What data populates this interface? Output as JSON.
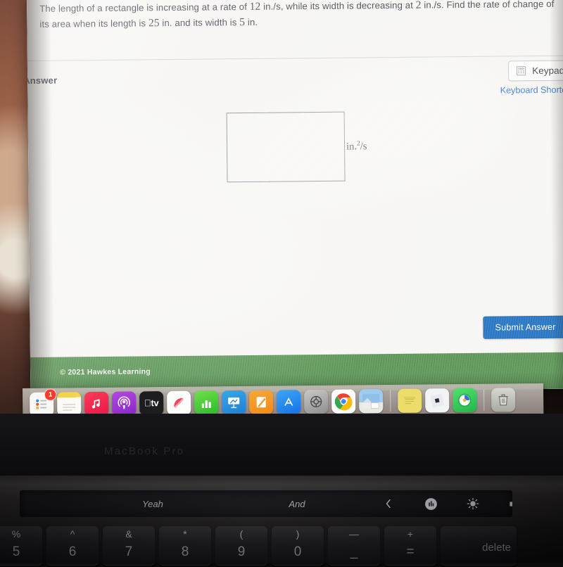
{
  "question": {
    "line1_a": "The length of a rectangle is increasing at a rate of ",
    "line1_n1": "12",
    "line1_b": " in./s, while its width is decreasing at ",
    "line1_n2": "2",
    "line1_c": " in./s. Find the rate of change of",
    "line2_a": "its area when its length is ",
    "line2_n1": "25",
    "line2_b": " in. and its width is ",
    "line2_n2": "5",
    "line2_c": " in."
  },
  "answer_panel": {
    "label": "Answer",
    "keypad_label": "Keypad",
    "keypad_icon": "calculator-icon",
    "keyboard_shortcuts_label": "Keyboard Shortcuts",
    "input_value": "",
    "input_placeholder": "",
    "units_base": "in.",
    "units_exponent": "2",
    "units_suffix": "/s",
    "submit_label": "Submit Answer"
  },
  "footer": {
    "copyright": "© 2021 Hawkes Learning",
    "bar_color": "#56914f"
  },
  "colors": {
    "submit_blue": "#1d6fc0",
    "link_blue": "#2f6fc4",
    "footer_green": "#56914f"
  },
  "dock": {
    "items": [
      {
        "name": "reminders",
        "icon": "reminders-icon",
        "badge": "1",
        "running": false
      },
      {
        "name": "notes",
        "icon": "notes-icon",
        "badge": "",
        "running": false
      },
      {
        "name": "music",
        "icon": "music-note-icon",
        "badge": "",
        "running": false
      },
      {
        "name": "podcasts",
        "icon": "podcasts-icon",
        "badge": "",
        "running": false
      },
      {
        "name": "apple-tv",
        "icon": "apple-tv-icon",
        "label": "tv",
        "badge": "",
        "running": false
      },
      {
        "name": "news",
        "icon": "news-icon",
        "badge": "",
        "running": false
      },
      {
        "name": "numbers",
        "icon": "numbers-bar-chart-icon",
        "badge": "",
        "running": false
      },
      {
        "name": "keynote",
        "icon": "keynote-podium-icon",
        "badge": "",
        "running": false
      },
      {
        "name": "pages",
        "icon": "pages-pen-icon",
        "badge": "",
        "running": false
      },
      {
        "name": "app-store",
        "icon": "app-store-icon",
        "badge": "",
        "running": false
      },
      {
        "name": "system-preferences",
        "icon": "gear-icon",
        "badge": "",
        "running": false
      },
      {
        "name": "google-chrome",
        "icon": "chrome-icon",
        "badge": "",
        "running": true
      },
      {
        "name": "preview",
        "icon": "preview-photo-icon",
        "badge": "",
        "running": false
      },
      {
        "name": "stickies",
        "icon": "sticky-note-icon",
        "badge": "",
        "running": false
      },
      {
        "name": "roblox",
        "icon": "roblox-icon",
        "badge": "",
        "running": false
      },
      {
        "name": "find-my",
        "icon": "find-my-icon",
        "badge": "",
        "running": false
      },
      {
        "name": "trash",
        "icon": "trash-icon",
        "badge": "",
        "running": false
      }
    ]
  },
  "laptop": {
    "model_label": "MacBook Pro"
  },
  "touch_bar": {
    "escape_label": "/",
    "suggestions": [
      "Yeah",
      "And"
    ],
    "controls": [
      {
        "name": "expand-left",
        "icon": "chevron-left-icon"
      },
      {
        "name": "media",
        "icon": "equalizer-icon"
      },
      {
        "name": "brightness",
        "icon": "brightness-icon"
      },
      {
        "name": "volume-up",
        "icon": "speaker-icon"
      },
      {
        "name": "mute",
        "icon": "speaker-mute-icon"
      }
    ],
    "siri_icon": "siri-icon"
  },
  "keyboard": {
    "keys": [
      {
        "top": "%",
        "bottom": "5"
      },
      {
        "top": "^",
        "bottom": "6"
      },
      {
        "top": "&",
        "bottom": "7"
      },
      {
        "top": "*",
        "bottom": "8"
      },
      {
        "top": "(",
        "bottom": "9"
      },
      {
        "top": ")",
        "bottom": "0"
      },
      {
        "top": "—",
        "bottom": "_"
      },
      {
        "top": "+",
        "bottom": "="
      }
    ],
    "delete_label": "delete"
  }
}
